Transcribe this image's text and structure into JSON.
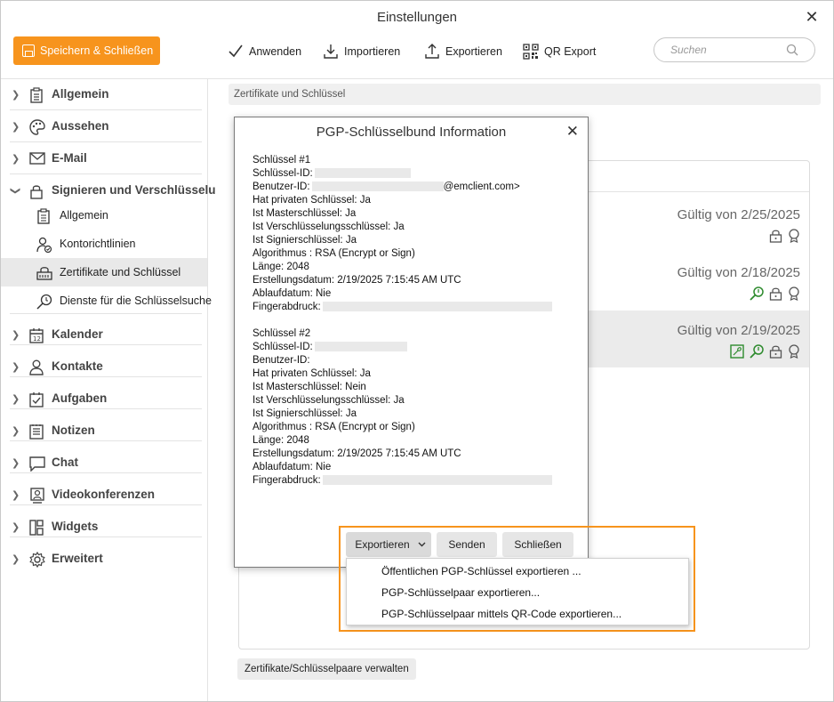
{
  "window": {
    "title": "Einstellungen"
  },
  "toolbar": {
    "save_label": "Speichern & Schließen",
    "apply_label": "Anwenden",
    "import_label": "Importieren",
    "export_label": "Exportieren",
    "qr_label": "QR Export",
    "search_placeholder": "Suchen"
  },
  "sidebar": {
    "items": [
      {
        "label": "Allgemein",
        "icon": "clipboard-icon"
      },
      {
        "label": "Aussehen",
        "icon": "palette-icon"
      },
      {
        "label": "E-Mail",
        "icon": "envelope-icon"
      },
      {
        "label": "Signieren und Verschlüsselu",
        "icon": "lock-icon"
      },
      {
        "label": "Kalender",
        "icon": "calendar-icon"
      },
      {
        "label": "Kontakte",
        "icon": "person-icon"
      },
      {
        "label": "Aufgaben",
        "icon": "task-icon"
      },
      {
        "label": "Notizen",
        "icon": "note-icon"
      },
      {
        "label": "Chat",
        "icon": "chat-icon"
      },
      {
        "label": "Videokonferenzen",
        "icon": "video-icon"
      },
      {
        "label": "Widgets",
        "icon": "widgets-icon"
      },
      {
        "label": "Erweitert",
        "icon": "gear-icon"
      }
    ],
    "subitems": [
      {
        "label": "Allgemein"
      },
      {
        "label": "Kontorichtlinien"
      },
      {
        "label": "Zertifikate und Schlüssel"
      },
      {
        "label": "Dienste für die Schlüsselsuche"
      }
    ]
  },
  "main": {
    "section_title": "Zertifikate und Schlüssel",
    "certs": [
      {
        "date": "Gültig von 2/25/2025"
      },
      {
        "date": "Gültig von 2/18/2025"
      },
      {
        "date": "Gültig von 2/19/2025"
      }
    ],
    "manage_label": "Zertifikate/Schlüsselpaare verwalten"
  },
  "dialog": {
    "title": "PGP-Schlüsselbund Information",
    "key1": {
      "header": "Schlüssel #1",
      "id_label": "Schlüssel-ID:",
      "user_label": "Benutzer-ID:",
      "user_suffix": "@emclient.com>",
      "private": "Hat privaten Schlüssel: Ja",
      "master": "Ist Masterschlüssel: Ja",
      "encrypt": "Ist Verschlüsselungsschlüssel: Ja",
      "sign": "Ist Signierschlüssel: Ja",
      "algo": "Algorithmus : RSA (Encrypt or Sign)",
      "length": "Länge: 2048",
      "created": "Erstellungsdatum: 2/19/2025 7:15:45 AM UTC",
      "expires": "Ablaufdatum: Nie",
      "fp_label": "Fingerabdruck:"
    },
    "key2": {
      "header": "Schlüssel #2",
      "id_label": "Schlüssel-ID:",
      "user_label": "Benutzer-ID:",
      "private": "Hat privaten Schlüssel: Ja",
      "master": "Ist Masterschlüssel: Nein",
      "encrypt": "Ist Verschlüsselungsschlüssel: Ja",
      "sign": "Ist Signierschlüssel: Ja",
      "algo": "Algorithmus : RSA (Encrypt or Sign)",
      "length": "Länge: 2048",
      "created": "Erstellungsdatum: 2/19/2025 7:15:45 AM UTC",
      "expires": "Ablaufdatum: Nie",
      "fp_label": "Fingerabdruck:"
    },
    "buttons": {
      "export": "Exportieren",
      "send": "Senden",
      "close": "Schließen"
    },
    "menu": [
      "Öffentlichen PGP-Schlüssel exportieren ...",
      "PGP-Schlüsselpaar exportieren...",
      "PGP-Schlüsselpaar mittels QR-Code exportieren..."
    ]
  },
  "colors": {
    "accent": "#f7941d",
    "green": "#2e8b2e"
  }
}
